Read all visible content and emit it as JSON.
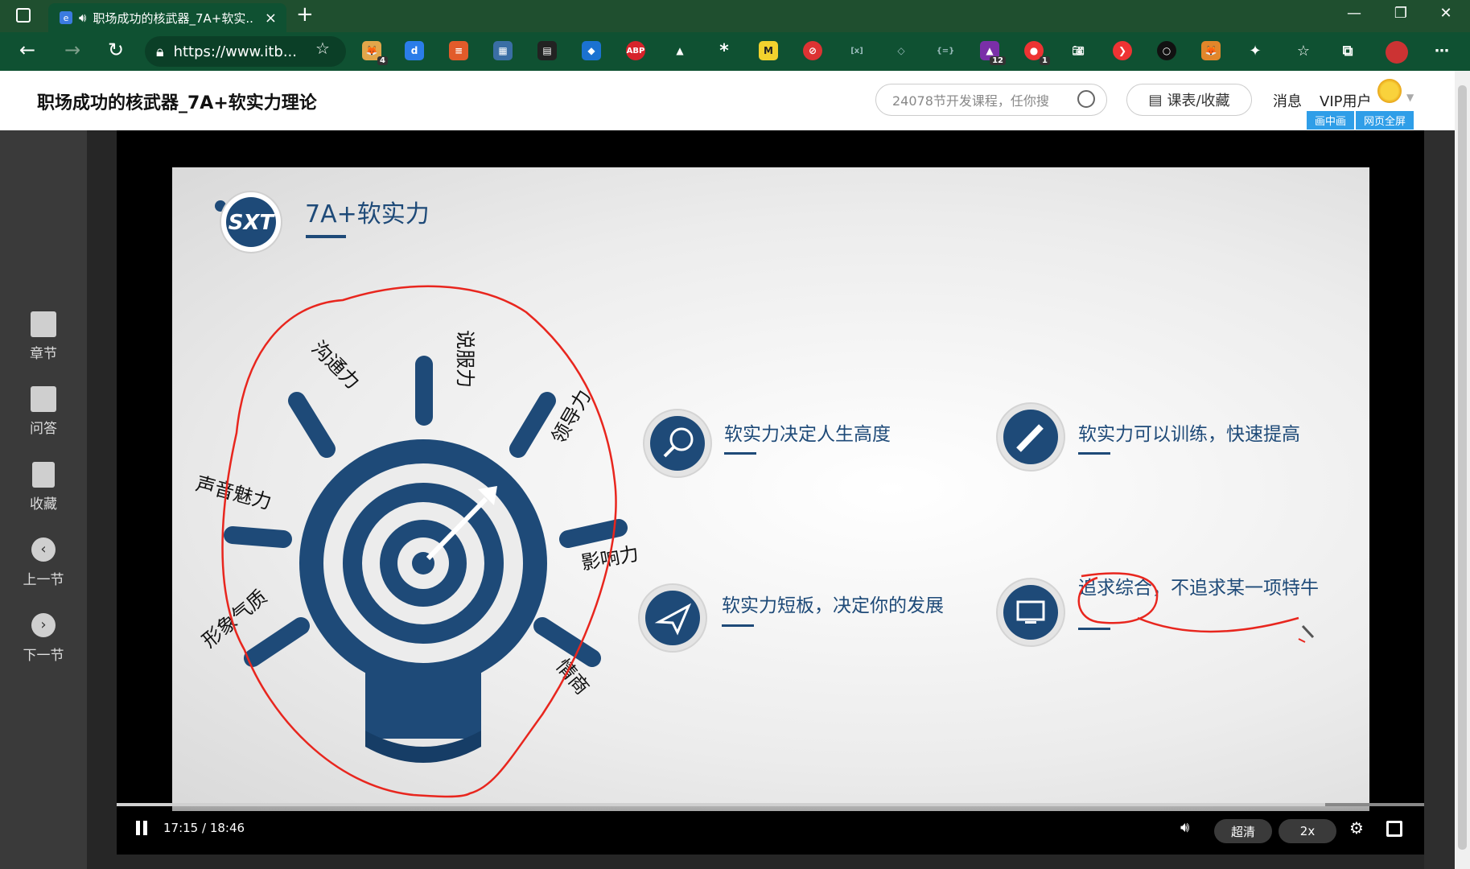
{
  "browser": {
    "tab_title": "职场成功的核武器_7A+软实...",
    "url": "https://www.itb...",
    "tab_close": "×",
    "new_tab": "+",
    "ext_badges": [
      "4",
      "12",
      "1"
    ]
  },
  "site": {
    "title": "职场成功的核武器_7A+软实力理论",
    "search_placeholder": "24078节开发课程，任你搜",
    "schedule_label": "课表/收藏",
    "messages_label": "消息",
    "user_label": "VIP用户",
    "pip_label": "画中画",
    "webfull_label": "网页全屏"
  },
  "sidebar": {
    "items": [
      {
        "label": "章节",
        "icon": "list-icon"
      },
      {
        "label": "问答",
        "icon": "chat-icon"
      },
      {
        "label": "收藏",
        "icon": "bookmark-icon"
      },
      {
        "label": "上一节",
        "icon": "chevron-left-icon"
      },
      {
        "label": "下一节",
        "icon": "chevron-right-icon"
      }
    ]
  },
  "slide": {
    "logo": "SXT",
    "heading": "7A+软实力",
    "bulb_labels": [
      "沟通力",
      "说服力",
      "领导力",
      "声音魅力",
      "影响力",
      "形象气质",
      "情商"
    ],
    "points": [
      {
        "text": "软实力决定人生高度",
        "icon": "magnifier-icon"
      },
      {
        "text": "软实力可以训练，快速提高",
        "icon": "pencil-icon"
      },
      {
        "text": "软实力短板，决定你的发展",
        "icon": "paper-plane-icon"
      },
      {
        "text": "追求综合，不追求某一项特牛",
        "icon": "monitor-icon"
      }
    ]
  },
  "player": {
    "time": "17:15 / 18:46",
    "progress": 0.924,
    "quality": "超清",
    "speed": "2x"
  },
  "colors": {
    "browser_green": "#0f5132",
    "slide_navy": "#1e4a78",
    "annotation_red": "#e8261e"
  }
}
